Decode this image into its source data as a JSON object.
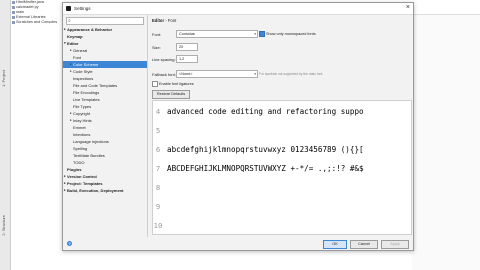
{
  "ide": {
    "tree": [
      "HtmlMinifier.java",
      "calcreader.py",
      "main",
      "External Libraries",
      "Scratches and Consoles"
    ],
    "left_tabs": [
      "1: Project",
      "2: Structure"
    ]
  },
  "dialog": {
    "title": "Settings",
    "close_glyph": "×",
    "search_placeholder": "",
    "tree": [
      {
        "label": "Appearance & Behavior",
        "level": 0,
        "arrow": "▸"
      },
      {
        "label": "Keymap",
        "level": 0,
        "arrow": ""
      },
      {
        "label": "Editor",
        "level": 0,
        "arrow": "▾"
      },
      {
        "label": "General",
        "level": 1,
        "arrow": "▸"
      },
      {
        "label": "Font",
        "level": 1,
        "arrow": ""
      },
      {
        "label": "Color Scheme",
        "level": 1,
        "arrow": "▸",
        "selected": true
      },
      {
        "label": "Code Style",
        "level": 1,
        "arrow": "▸"
      },
      {
        "label": "Inspections",
        "level": 1,
        "arrow": ""
      },
      {
        "label": "File and Code Templates",
        "level": 1,
        "arrow": ""
      },
      {
        "label": "File Encodings",
        "level": 1,
        "arrow": ""
      },
      {
        "label": "Live Templates",
        "level": 1,
        "arrow": ""
      },
      {
        "label": "File Types",
        "level": 1,
        "arrow": ""
      },
      {
        "label": "Copyright",
        "level": 1,
        "arrow": "▸"
      },
      {
        "label": "Inlay Hints",
        "level": 1,
        "arrow": "▸"
      },
      {
        "label": "Emmet",
        "level": 1,
        "arrow": ""
      },
      {
        "label": "Intentions",
        "level": 1,
        "arrow": ""
      },
      {
        "label": "Language Injections",
        "level": 1,
        "arrow": ""
      },
      {
        "label": "Spelling",
        "level": 1,
        "arrow": ""
      },
      {
        "label": "TextMate Bundles",
        "level": 1,
        "arrow": ""
      },
      {
        "label": "TODO",
        "level": 1,
        "arrow": ""
      },
      {
        "label": "Plugins",
        "level": 0,
        "arrow": ""
      },
      {
        "label": "Version Control",
        "level": 0,
        "arrow": "▸"
      },
      {
        "label": "Project: Templates",
        "level": 0,
        "arrow": "▸"
      },
      {
        "label": "Build, Execution, Deployment",
        "level": 0,
        "arrow": "▸"
      }
    ],
    "breadcrumb": {
      "section": "Editor",
      "separator": "›",
      "page": "Font"
    },
    "font": {
      "label": "Font:",
      "value": "Consolas",
      "mono_only_label": "Show only monospaced fonts",
      "mono_only_checked": true
    },
    "size": {
      "label": "Size:",
      "value": "20"
    },
    "line_spacing": {
      "label": "Line spacing:",
      "value": "1.2"
    },
    "fallback": {
      "label": "Fallback font:",
      "value": "<None>",
      "hint": "For symbols not supported by the main font"
    },
    "ligatures": {
      "label": "Enable font ligatures",
      "checked": false
    },
    "restore_button": "Restore Defaults",
    "preview_lines": [
      {
        "num": "4",
        "text": "advanced code editing and refactoring suppo"
      },
      {
        "num": "5",
        "text": ""
      },
      {
        "num": "6",
        "text": "abcdefghijklmnopqrstuvwxyz 0123456789 (){}["
      },
      {
        "num": "7",
        "text": "ABCDEFGHIJKLMNOPQRSTUVWXYZ +-*/= .,;:!? #&$"
      },
      {
        "num": "8",
        "text": ""
      },
      {
        "num": "9",
        "text": ""
      },
      {
        "num": "10",
        "text": ""
      }
    ],
    "footer": {
      "help": "?",
      "ok": "OK",
      "cancel": "Cancel",
      "apply": "Apply"
    }
  }
}
